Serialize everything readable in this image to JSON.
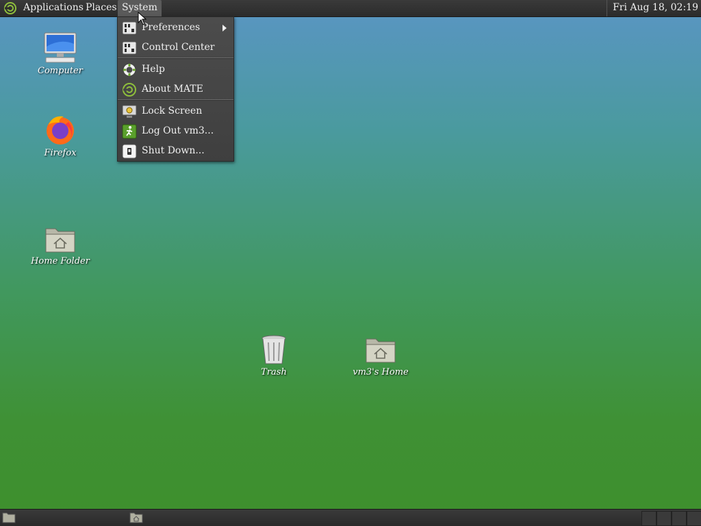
{
  "top_panel": {
    "menus": [
      "Applications",
      "Places",
      "System"
    ],
    "clock": "Fri Aug 18, 02:19"
  },
  "system_menu": {
    "items": [
      {
        "label": "Preferences",
        "icon": "preferences-icon",
        "submenu": true
      },
      {
        "label": "Control Center",
        "icon": "control-center-icon"
      },
      {
        "label": "Help",
        "icon": "help-lifebuoy-icon"
      },
      {
        "label": "About MATE",
        "icon": "mate-logo-icon"
      },
      {
        "label": "Lock Screen",
        "icon": "lock-screen-icon"
      },
      {
        "label": "Log Out vm3...",
        "icon": "log-out-icon"
      },
      {
        "label": "Shut Down...",
        "icon": "shutdown-icon"
      }
    ]
  },
  "desktop_icons": [
    {
      "label": "Computer",
      "icon": "computer-icon"
    },
    {
      "label": "Firefox",
      "icon": "firefox-icon"
    },
    {
      "label": "Home Folder",
      "icon": "home-folder-icon"
    },
    {
      "label": "Trash",
      "icon": "trash-icon"
    },
    {
      "label": "vm3's Home",
      "icon": "home-folder-icon"
    }
  ],
  "colors": {
    "panel": "#2e2e2e",
    "menu_bg": "#454545",
    "desktop_top": "#5a95c4",
    "desktop_bottom": "#3e8f2c"
  }
}
